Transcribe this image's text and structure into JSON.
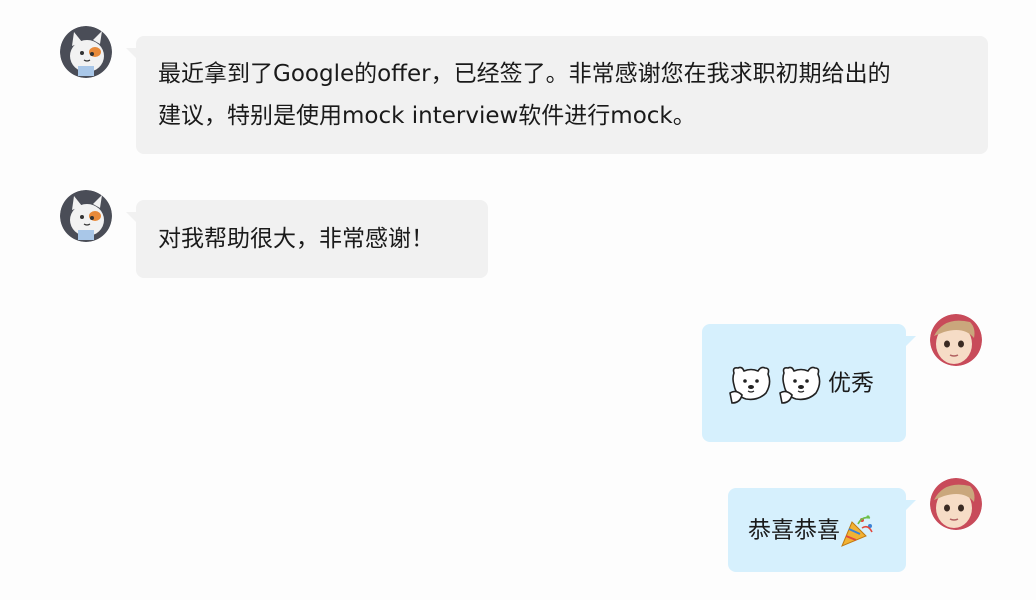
{
  "messages": [
    {
      "side": "in",
      "lines": [
        "最近拿到了Google的offer，已经签了。非常感谢您在我求职初期给出的",
        "建议，特别是使用mock interview软件进行mock。"
      ]
    },
    {
      "side": "in",
      "text": "对我帮助很大，非常感谢！"
    },
    {
      "side": "out",
      "emoji": [
        "polar-bear-sticker",
        "polar-bear-sticker"
      ],
      "text": "优秀"
    },
    {
      "side": "out",
      "text": "恭喜恭喜",
      "emoji_after": "party-popper"
    }
  ],
  "colors": {
    "incoming_bubble": "#f1f1f1",
    "outgoing_bubble": "#d6f0fd",
    "background": "#fdfdfd"
  }
}
